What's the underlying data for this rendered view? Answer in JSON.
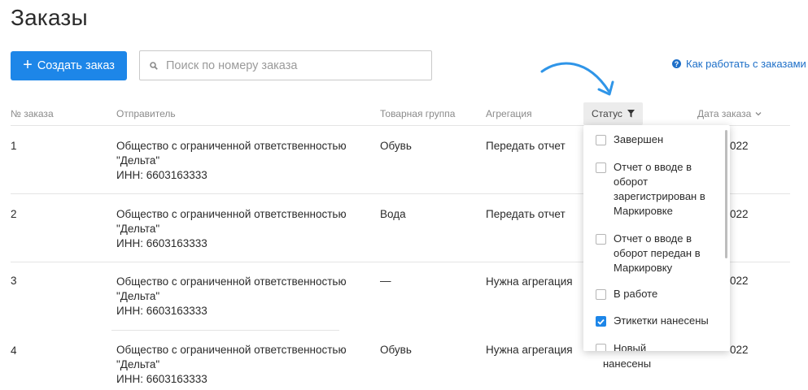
{
  "page": {
    "title": "Заказы"
  },
  "toolbar": {
    "create_label": "Создать заказ",
    "search_placeholder": "Поиск по номеру заказа",
    "help_label": "Как работать с заказами"
  },
  "table": {
    "headers": {
      "number": "№ заказа",
      "sender": "Отправитель",
      "group": "Товарная группа",
      "aggregation": "Агрегация",
      "status": "Статус",
      "date": "Дата заказа"
    },
    "rows": [
      {
        "number": "1",
        "sender_line1": "Общество с ограниченной ответственностью",
        "sender_line2": "\"Дельта\"",
        "sender_inn": "ИНН: 6603163333",
        "group": "Обувь",
        "aggregation": "Передать отчет",
        "date_fragment": "022"
      },
      {
        "number": "2",
        "sender_line1": "Общество с ограниченной ответственностью",
        "sender_line2": "\"Дельта\"",
        "sender_inn": "ИНН: 6603163333",
        "group": "Вода",
        "aggregation": "Передать отчет",
        "date_fragment": "022"
      },
      {
        "number": "3",
        "sender_line1": "Общество с ограниченной ответственностью",
        "sender_line2": "\"Дельта\"",
        "sender_inn": "ИНН: 6603163333",
        "group": "—",
        "aggregation": "Нужна агрегация",
        "date_fragment": "022"
      },
      {
        "number": "4",
        "sender_line1": "Общество с ограниченной ответственностью",
        "sender_line2": "\"Дельта\"",
        "sender_inn": "ИНН: 6603163333",
        "group": "Обувь",
        "aggregation": "Нужна агрегация",
        "date_fragment": "022"
      }
    ]
  },
  "status_filter": {
    "options": [
      {
        "label": "Завершен",
        "checked": false
      },
      {
        "label": "Отчет о вводе в оборот зарегистрирован в Маркировке",
        "checked": false
      },
      {
        "label": "Отчет о вводе в оборот передан в Маркировку",
        "checked": false
      },
      {
        "label": "В работе",
        "checked": false
      },
      {
        "label": "Этикетки нанесены",
        "checked": true
      },
      {
        "label": "Новый",
        "checked": false
      }
    ],
    "behind_text": "нанесены"
  },
  "colors": {
    "accent": "#1d86e8",
    "link": "#1d6fc8"
  },
  "icons": {
    "search": "search-icon",
    "filter": "filter-icon",
    "help": "help-icon",
    "chevron": "chevron-down-icon",
    "check": "check-icon"
  }
}
